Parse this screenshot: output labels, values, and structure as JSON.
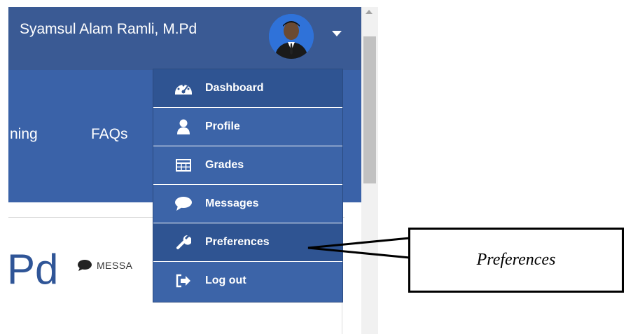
{
  "header": {
    "username": "Syamsul Alam Ramli, M.Pd"
  },
  "nav": {
    "links": [
      "ning",
      "FAQs"
    ]
  },
  "content": {
    "name_fragment": "Pd",
    "message_label": "MESSA"
  },
  "menu": {
    "items": [
      {
        "label": "Dashboard",
        "icon": "dashboard-icon"
      },
      {
        "label": "Profile",
        "icon": "user-icon"
      },
      {
        "label": "Grades",
        "icon": "table-icon"
      },
      {
        "label": "Messages",
        "icon": "comment-icon"
      },
      {
        "label": "Preferences",
        "icon": "wrench-icon"
      },
      {
        "label": "Log out",
        "icon": "sign-out-icon"
      }
    ]
  },
  "callout": {
    "text": "Preferences"
  },
  "colors": {
    "header_bg": "#3a5a94",
    "nav_bg": "#3a62a8",
    "menu_bg": "#3c64a8",
    "menu_active_bg": "#2f5492"
  }
}
